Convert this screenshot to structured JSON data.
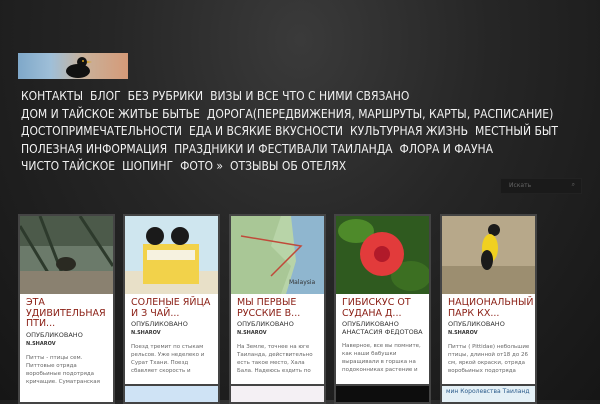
{
  "nav": {
    "items": [
      "КОНТАКТЫ",
      "БЛОГ",
      "БЕЗ РУБРИКИ",
      "ВИЗЫ И ВСЕ ЧТО С НИМИ СВЯЗАНО",
      "ДОМ И ТАЙСКОЕ ЖИТЬЕ БЫТЬЕ",
      "ДОРОГА(ПЕРЕДВИЖЕНИЯ, МАРШРУТЫ, КАРТЫ, РАСПИСАНИЕ)",
      "ДОСТОПРИМЕЧАТЕЛЬНОСТИ",
      "ЕДА И ВСЯКИЕ ВКУСНОСТИ",
      "КУЛЬТУРНАЯ ЖИЗНЬ",
      "МЕСТНЫЙ БЫТ",
      "ПОЛЕЗНАЯ ИНФОРМАЦИЯ",
      "ПРАЗДНИКИ И ФЕСТИВАЛИ ТАИЛАНДА",
      "ФЛОРА И ФАУНА",
      "ЧИСТО ТАЙСКОЕ",
      "ШОПИНГ",
      "ФОТО »",
      "ОТЗЫВЫ ОБ ОТЕЛЯХ"
    ]
  },
  "search": {
    "placeholder": "Искать"
  },
  "cards": [
    {
      "title": "ЭТА УДИВИТЕЛЬНАЯ ПТИ...",
      "by_prefix": "ОПУБЛИКОВАНО",
      "author": "N.SHAROV",
      "excerpt": "Питты - птицы сем. Питтовые отряда воробьиные подотряда кричащие. Суматранская"
    },
    {
      "title": "СОЛЕНЫЕ ЯЙЦА И З ЧАЙ...",
      "by_prefix": "ОПУБЛИКОВАНО",
      "author": "N.SHAROV",
      "excerpt": "Поезд тремит по стыкам рельсов. Уже неделеко и Сурат Тхани. Поезд сбавляет скорость и"
    },
    {
      "title": "МЫ ПЕРВЫЕ РУССКИЕ В...",
      "by_prefix": "ОПУБЛИКОВАНО",
      "author": "N.SHAROV",
      "excerpt": "На Земле, точнее на юге Таиланда, действительно есть такое место, Хала Бала. Надеюсь ездить по"
    },
    {
      "title": "ГИБИСКУС ОТ СУДАНА Д...",
      "by_prefix": "ОПУБЛИКОВАНО",
      "author": "АНАСТАСИЯ ФЕДОТОВА",
      "excerpt": "Наверное, все вы помните, как наши бабушки выращивали в горшка на подоконниках растение и"
    },
    {
      "title": "НАЦИОНАЛЬНЫЙ ПАРК КХ...",
      "by_prefix": "ОПУБЛИКОВАНО",
      "author": "N.SHAROV",
      "excerpt": "Питты ( Pittidae) небольшие птицы, длинной от18 до 26 см, яркой окраски, отряда воробьиных подотряда"
    }
  ],
  "map_label": "Malaysia",
  "row2_caption": "мин Королевства Таиланд"
}
